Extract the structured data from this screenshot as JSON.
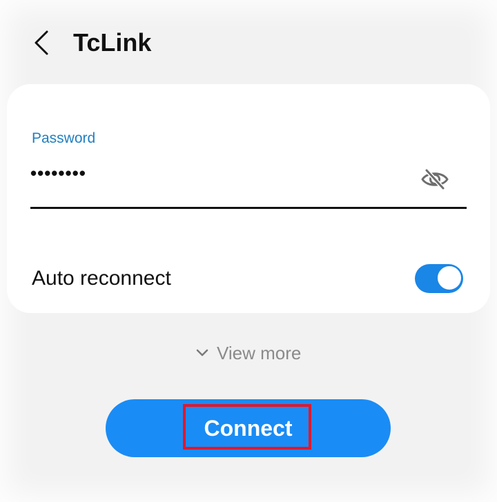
{
  "header": {
    "title": "TcLink",
    "back_icon": "chevron-left-icon"
  },
  "password": {
    "label": "Password",
    "value": "••••••••",
    "visibility_icon": "eye-off-icon"
  },
  "auto_reconnect": {
    "label": "Auto reconnect",
    "enabled": true
  },
  "view_more": {
    "label": "View more",
    "icon": "chevron-down-icon"
  },
  "connect": {
    "label": "Connect"
  },
  "colors": {
    "accent_blue": "#1a8cf5",
    "label_blue": "#1f7fc1",
    "highlight_red": "#e3172b"
  }
}
